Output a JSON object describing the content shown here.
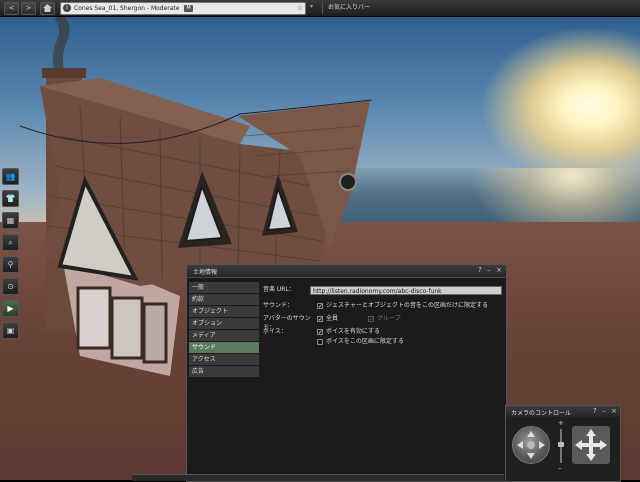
{
  "toolbar": {
    "back_icon": "<",
    "forward_icon": ">",
    "home_icon": "home-icon",
    "location": "Cones Sea_01, Shergon - Moderate",
    "rating_badge": "M",
    "favorite_icon": "star-icon",
    "search_label": "",
    "my_location_label": "お気に入りバー"
  },
  "sidebar": {
    "items": [
      {
        "name": "people",
        "glyph": "👥"
      },
      {
        "name": "appearance",
        "glyph": "👕"
      },
      {
        "name": "inventory",
        "glyph": "▦"
      },
      {
        "name": "search",
        "glyph": "⌕"
      },
      {
        "name": "places",
        "glyph": "⚲"
      },
      {
        "name": "settings",
        "glyph": "⊙"
      },
      {
        "name": "media",
        "glyph": "▶"
      },
      {
        "name": "profile",
        "glyph": "▣"
      }
    ]
  },
  "land": {
    "title": "土地情報",
    "help": "?",
    "minimize": "–",
    "close": "×",
    "tabs": [
      "一般",
      "約款",
      "オブジェクト",
      "オプション",
      "メディア",
      "サウンド",
      "アクセス",
      "広告"
    ],
    "selected_tab": "サウンド",
    "music_url_label": "音楽 URL：",
    "music_url_value": "http://listen.radionomy.com/abc-disco-funk",
    "sound_label": "サウンド：",
    "sound_gesture_text": "ジェスチャーとオブジェクトの音をこの区画だけに限定する",
    "avatar_sound_label": "アバターのサウンド：",
    "avatar_all_text": "全員",
    "avatar_group_text": "グループ",
    "voice_label": "ボイス：",
    "voice_enable_text": "ボイスを有効にする",
    "voice_restrict_text": "ボイスをこの区画に限定する"
  },
  "camera": {
    "title": "カメラのコントロール",
    "help": "?",
    "minimize": "–",
    "close": "×",
    "zoom_plus": "+",
    "zoom_minus": "–"
  },
  "colors": {
    "selected_tab": "#5b7a5b",
    "panel_bg": "#191919",
    "url_field": "#cfcfcf"
  }
}
